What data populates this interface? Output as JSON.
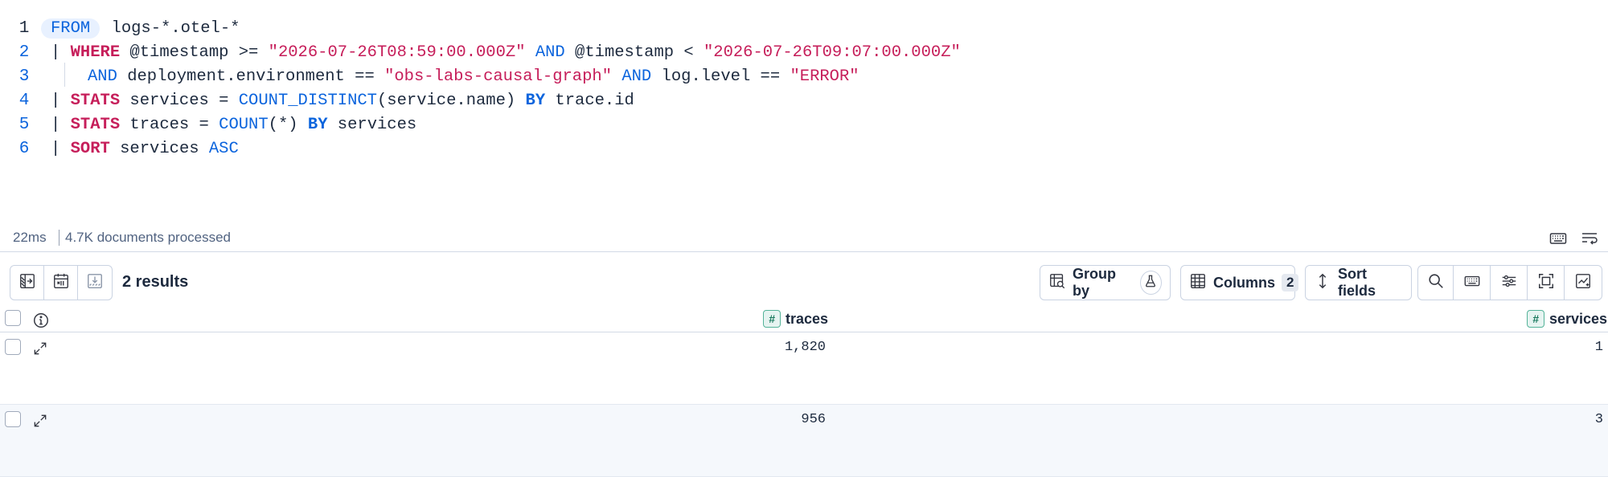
{
  "editor": {
    "lines": [
      {
        "number": "1",
        "kw": "FROM",
        "rest": " logs-*.otel-*"
      },
      {
        "number": "2",
        "pipe": "| ",
        "kw": "WHERE",
        "p1": " @timestamp >= ",
        "s1": "\"2026-07-26T08:59:00.000Z\"",
        "op": "AND",
        "p2": " @timestamp < ",
        "s2": "\"2026-07-26T09:07:00.000Z\""
      },
      {
        "number": "3",
        "op1": "AND",
        "p1": " deployment.environment == ",
        "s1": "\"obs-labs-causal-graph\"",
        "op2": "AND",
        "p2": " log.level == ",
        "s2": "\"ERROR\""
      },
      {
        "number": "4",
        "pipe": "| ",
        "kw": "STATS",
        "p1": " services = ",
        "fn": "COUNT_DISTINCT",
        "p2": "(service.name) ",
        "by": "BY",
        "p3": " trace.id"
      },
      {
        "number": "5",
        "pipe": "| ",
        "kw": "STATS",
        "p1": " traces = ",
        "fn": "COUNT",
        "p2": "(*) ",
        "by": "BY",
        "p3": " services"
      },
      {
        "number": "6",
        "pipe": "| ",
        "kw": "SORT",
        "p1": " services ",
        "dir": "ASC"
      }
    ]
  },
  "status": {
    "time": "22ms",
    "documents": "4.7K documents processed",
    "icons": [
      "keyboard-icon",
      "wrap-lines-icon"
    ]
  },
  "toolbar": {
    "results": "2 results",
    "group_by": "Group by",
    "columns": "Columns",
    "columns_count": "2",
    "sort_fields": "Sort fields",
    "left_icons": [
      "toggle-sidebar-icon",
      "date-picker-icon",
      "download-icon"
    ],
    "right_icons": [
      "search-icon",
      "keyboard-icon",
      "display-settings-icon",
      "fullscreen-icon",
      "add-chart-icon"
    ]
  },
  "grid": {
    "columns": [
      {
        "name": "traces",
        "type_glyph": "#"
      },
      {
        "name": "services",
        "type_glyph": "#"
      }
    ],
    "rows": [
      {
        "traces": "1,820",
        "services": "1"
      },
      {
        "traces": "956",
        "services": "3"
      }
    ]
  },
  "colors": {
    "keyword_pipe": "#c61e5a",
    "keyword_blue": "#0b64dd",
    "string": "#c61e5a",
    "text": "#1d2a3e",
    "muted": "#516381",
    "border": "#cad3e2",
    "number_token": "#54b399"
  }
}
